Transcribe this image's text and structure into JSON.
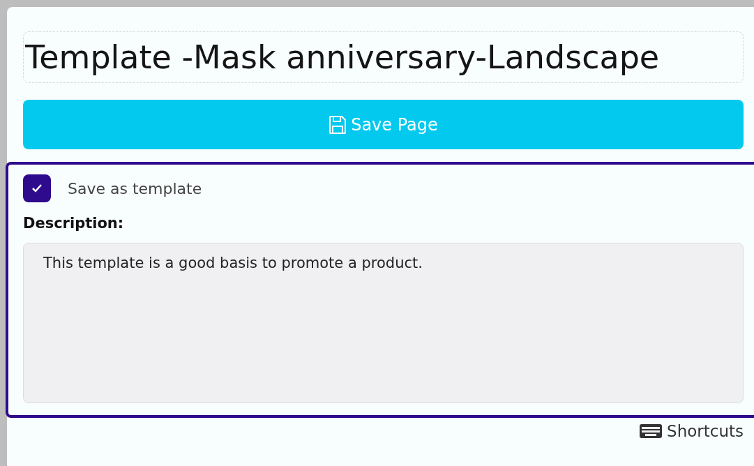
{
  "title_field": {
    "value": "Template -Mask anniversary-Landscape"
  },
  "save_button": {
    "label": "Save Page"
  },
  "template_section": {
    "active": true,
    "save_as_template": {
      "label": "Save as template",
      "checked": true
    },
    "description_label": "Description:",
    "description": {
      "value": "This template is a good basis to promote a product."
    }
  },
  "shortcuts_link": {
    "label": "Shortcuts"
  }
}
